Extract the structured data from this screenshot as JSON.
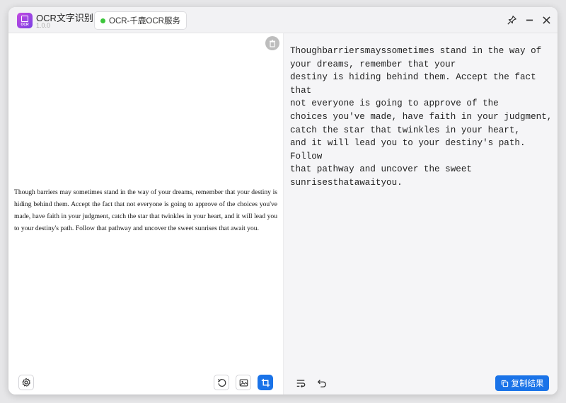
{
  "app": {
    "title": "OCR文字识别",
    "version": "1.0.0",
    "icon_tag": "OCR"
  },
  "service": {
    "label": "OCR-千鹿OCR服务",
    "status_color": "#3cc63c"
  },
  "window_controls": {
    "pin": "pin-icon",
    "minimize": "minimize-icon",
    "close": "close-icon"
  },
  "image_panel": {
    "text": "Though barriers may sometimes stand in the way of your dreams, remember that your destiny is hiding behind them. Accept the fact that not everyone is going to approve of the choices you've made, have faith in your judgment, catch the star that twinkles in your heart, and it will lead you to your destiny's path. Follow that pathway and uncover the sweet sunrises that await you."
  },
  "result_panel": {
    "text": "Thoughbarriersmayssometimes stand in the way of\nyour dreams, remember that your\ndestiny is hiding behind them. Accept the fact that\nnot everyone is going to approve of the\nchoices you've made, have faith in your judgment,\ncatch the star that twinkles in your heart,\nand it will lead you to your destiny's path. Follow\nthat pathway and uncover the sweet\nsunrisesthatawaityou."
  },
  "footer": {
    "copy_label": "复制结果",
    "accent": "#1a73e8"
  }
}
